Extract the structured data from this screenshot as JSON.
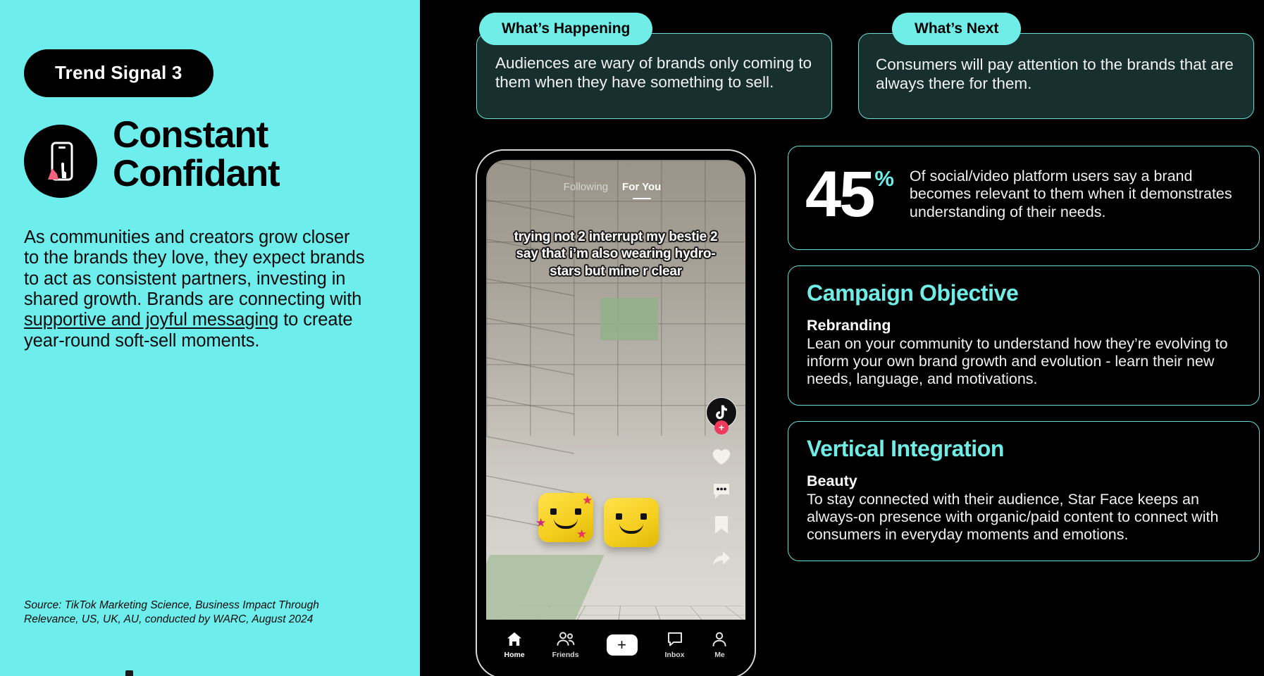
{
  "theme": {
    "cyan": "#6EEDED",
    "accent_cyan": "#6FEDE6",
    "card_teal": "#17302E",
    "border_cyan": "#63DED8",
    "black": "#000000",
    "pink": "#EE3A5C"
  },
  "left": {
    "trend_pill": "Trend Signal 3",
    "icon_name": "phone-hand-icon",
    "title_line1": "Constant",
    "title_line2": "Confidant",
    "body_part1": "As communities and creators grow closer to the brands they love, they expect brands to act as consistent partners, investing in shared growth. Brands are connecting with ",
    "body_link": "supportive and joyful messaging",
    "body_part2": " to create year-round soft-sell moments.",
    "source": "Source: TikTok Marketing Science, Business Impact Through Relevance, US, UK, AU, conducted by WARC, August 2024"
  },
  "top_cards": [
    {
      "tab": "What’s Happening",
      "body": "Audiences are wary of brands only coming to them when they have something to sell."
    },
    {
      "tab": "What’s Next",
      "body": "Consumers will pay attention to the brands that are always there for them."
    }
  ],
  "stat": {
    "number": "45",
    "percent": "%",
    "description": "Of social/video platform users say a brand becomes relevant to them when it demonstrates understanding of their needs."
  },
  "info_cards": [
    {
      "title": "Campaign Objective",
      "subtitle": "Rebranding",
      "body": "Lean on your community to understand how they’re evolving to inform your own brand growth and evolution - learn their new needs, language, and motivations."
    },
    {
      "title": "Vertical Integration",
      "subtitle": "Beauty",
      "body": "To stay connected with their audience, Star Face keeps an always-on presence with organic/paid content to connect with consumers in everyday moments and emotions."
    }
  ],
  "phone": {
    "tabs": [
      {
        "label": "Following",
        "active": false
      },
      {
        "label": "For You",
        "active": true
      }
    ],
    "caption": "trying not 2 interrupt my bestie 2 say that i’m also wearing hydro-stars but mine r clear",
    "rail": {
      "avatar_icon": "tiktok-avatar-icon",
      "follow_badge": "+",
      "like_icon": "heart-icon",
      "comment_icon": "comment-icon",
      "bookmark_icon": "bookmark-icon",
      "share_icon": "share-icon"
    },
    "nav": [
      {
        "label": "Home",
        "icon": "home-icon"
      },
      {
        "label": "Friends",
        "icon": "friends-icon"
      },
      {
        "label": "",
        "icon": "create-plus-icon"
      },
      {
        "label": "Inbox",
        "icon": "inbox-icon"
      },
      {
        "label": "Me",
        "icon": "profile-icon"
      }
    ]
  }
}
